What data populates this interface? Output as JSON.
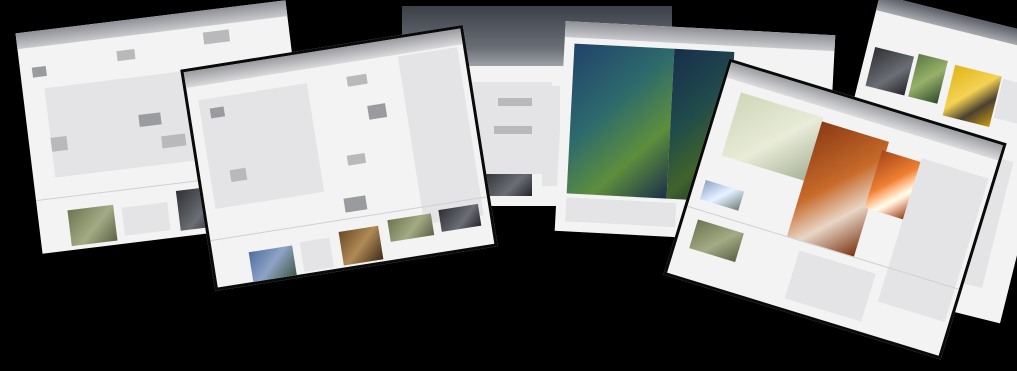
{
  "view": {
    "mode": "window-switcher",
    "windows": [
      {
        "id": "window-1",
        "active": false
      },
      {
        "id": "window-2",
        "active": true
      },
      {
        "id": "window-3",
        "active": false
      },
      {
        "id": "window-4",
        "active": false
      },
      {
        "id": "window-5",
        "active": true
      },
      {
        "id": "window-6",
        "active": false
      }
    ]
  },
  "colors": {
    "background": "#000000",
    "page": "#f3f3f3",
    "frame": "#0a0a0a"
  }
}
